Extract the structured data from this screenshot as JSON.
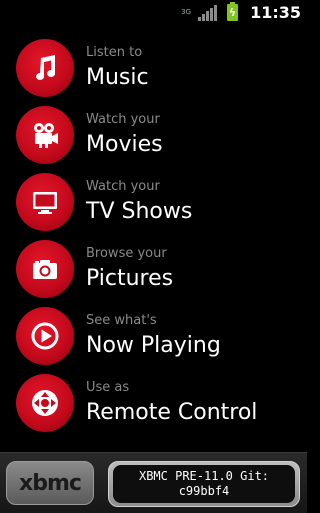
{
  "status_bar": {
    "network": "3G",
    "battery_icon": "battery-charging-icon",
    "time": "11:35"
  },
  "menu": [
    {
      "small": "Listen to",
      "big": "Music",
      "icon": "music-note-icon"
    },
    {
      "small": "Watch your",
      "big": "Movies",
      "icon": "film-camera-icon"
    },
    {
      "small": "Watch your",
      "big": "TV Shows",
      "icon": "tv-icon"
    },
    {
      "small": "Browse your",
      "big": "Pictures",
      "icon": "camera-icon"
    },
    {
      "small": "See what's",
      "big": "Now Playing",
      "icon": "play-icon"
    },
    {
      "small": "Use as",
      "big": "Remote Control",
      "icon": "remote-dpad-icon"
    }
  ],
  "footer": {
    "logo": "xbmc",
    "version_line1": "XBMC PRE-11.0 Git:",
    "version_line2": "c99bbf4"
  },
  "colors": {
    "accent_red": "#c40a1c",
    "background": "#000000"
  }
}
